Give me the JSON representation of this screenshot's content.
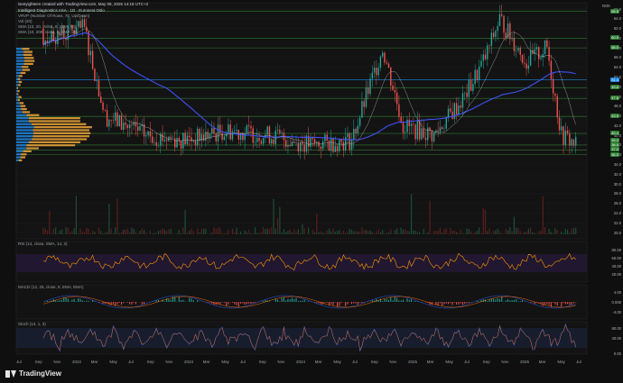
{
  "header": {
    "credit": "iseeyighteen created with TradingView.com, May 08, 2026 14:18 UTC+2",
    "symbol_line": "Intelligent Diagnostics ASA · 1D · Euronext Oslo",
    "vrvp_line": "VRVP (Number Of Rows, 70, Up/Down)",
    "vol_line": "Vol (20)",
    "sma1_line": "SMA (10, 20, Volse, 0, SMA, 50)",
    "sma2_line": "SMA (10, 200, close, 0, SMA, 20)"
  },
  "currency": "NOK",
  "price_scale": [
    "66.0",
    "64.0",
    "62.0",
    "60.0",
    "58.0",
    "56.0",
    "54.0",
    "52.0",
    "50.0",
    "48.0",
    "46.0",
    "44.0",
    "42.0",
    "40.0",
    "38.0",
    "36.0",
    "34.0",
    "32.0",
    "30.0",
    "28.0",
    "26.0",
    "24.0",
    "22.0",
    "20.0"
  ],
  "price_tags": [
    {
      "label": "65.5",
      "color": "#2e7d32"
    },
    {
      "label": "60.0",
      "color": "#2e7d32"
    },
    {
      "label": "58.0",
      "color": "#2e7d32"
    },
    {
      "label": "51.4",
      "color": "#1e88e5"
    },
    {
      "label": "49.8",
      "color": "#2e7d32"
    },
    {
      "label": "47.6",
      "color": "#2e7d32"
    },
    {
      "label": "43.9",
      "color": "#2e7d32"
    },
    {
      "label": "40.4",
      "color": "#2e7d32"
    },
    {
      "label": "39.0",
      "color": "#2e7d32"
    },
    {
      "label": "38.0",
      "color": "#2e7d32"
    },
    {
      "label": "37.0",
      "color": "#2e7d32"
    },
    {
      "label": "36.0",
      "color": "#2e7d32"
    }
  ],
  "rsi": {
    "label": "RSI (14, close, SMA, 14, 2)",
    "scale": [
      "80.00",
      "60.00",
      "40.00",
      "20.00"
    ]
  },
  "macd": {
    "label": "MACD (12, 26, close, 9, EMA, EMA)",
    "scale": [
      "4.00",
      "0.000",
      "-4.00"
    ]
  },
  "stoch": {
    "label": "Stoch (14, 1, 3)",
    "scale": [
      "80.00",
      "40.00",
      "0.00"
    ]
  },
  "x_axis": [
    "Jul",
    "Sep",
    "Nov",
    "2022",
    "Mar",
    "May",
    "Jul",
    "Sep",
    "Nov",
    "2023",
    "Mar",
    "May",
    "Jul",
    "Sep",
    "Nov",
    "2024",
    "Mar",
    "May",
    "Jul",
    "Sep",
    "Nov",
    "2025",
    "Mar",
    "May",
    "Jul",
    "Sep",
    "Nov",
    "2026",
    "Mar",
    "May",
    "Jul"
  ],
  "brand": "TradingView",
  "colors": {
    "up": "#26a69a",
    "down": "#ef5350",
    "sma_blue": "#3f51f5",
    "rsi": "#ff9800",
    "vp_up": "#1e88e5",
    "vp_down": "#f2a93b"
  }
}
